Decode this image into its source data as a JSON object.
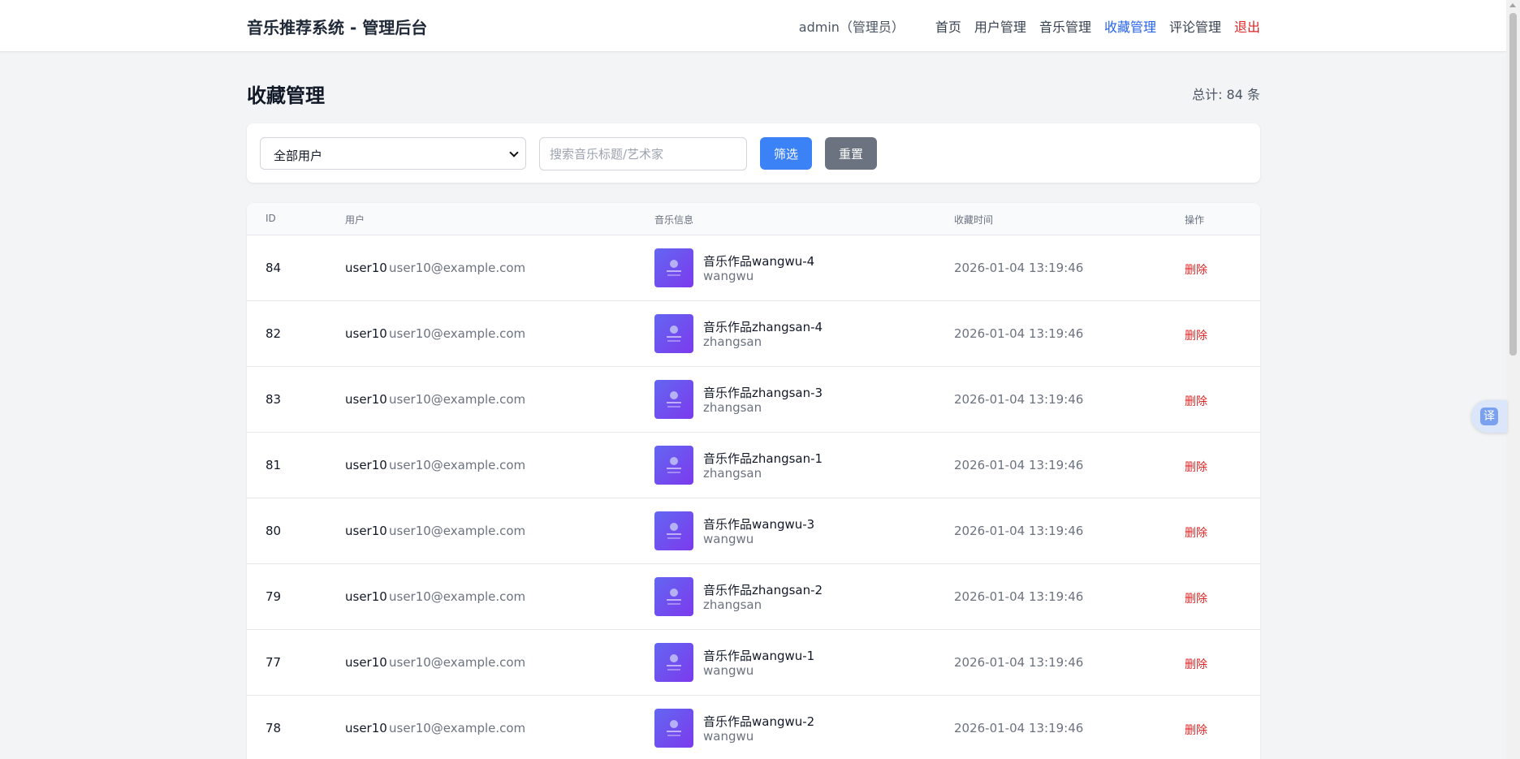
{
  "header": {
    "brand": "音乐推荐系统 - 管理后台",
    "current_user": "admin（管理员）",
    "nav": [
      "首页",
      "用户管理",
      "音乐管理",
      "收藏管理",
      "评论管理",
      "退出"
    ],
    "active_nav": "收藏管理"
  },
  "page": {
    "title": "收藏管理",
    "total": "总计: 84 条"
  },
  "filter": {
    "user_select_value": "全部用户",
    "search_placeholder": "搜索音乐标题/艺术家",
    "filter_button": "筛选",
    "reset_button": "重置"
  },
  "table": {
    "headers": [
      "ID",
      "用户",
      "音乐信息",
      "收藏时间",
      "操作"
    ],
    "rows": [
      {
        "id": "84",
        "username": "user10",
        "email": "user10@example.com",
        "title": "音乐作品wangwu-4",
        "artist": "wangwu",
        "time": "2026-01-04 13:19:46",
        "action": "删除"
      },
      {
        "id": "82",
        "username": "user10",
        "email": "user10@example.com",
        "title": "音乐作品zhangsan-4",
        "artist": "zhangsan",
        "time": "2026-01-04 13:19:46",
        "action": "删除"
      },
      {
        "id": "83",
        "username": "user10",
        "email": "user10@example.com",
        "title": "音乐作品zhangsan-3",
        "artist": "zhangsan",
        "time": "2026-01-04 13:19:46",
        "action": "删除"
      },
      {
        "id": "81",
        "username": "user10",
        "email": "user10@example.com",
        "title": "音乐作品zhangsan-1",
        "artist": "zhangsan",
        "time": "2026-01-04 13:19:46",
        "action": "删除"
      },
      {
        "id": "80",
        "username": "user10",
        "email": "user10@example.com",
        "title": "音乐作品wangwu-3",
        "artist": "wangwu",
        "time": "2026-01-04 13:19:46",
        "action": "删除"
      },
      {
        "id": "79",
        "username": "user10",
        "email": "user10@example.com",
        "title": "音乐作品zhangsan-2",
        "artist": "zhangsan",
        "time": "2026-01-04 13:19:46",
        "action": "删除"
      },
      {
        "id": "77",
        "username": "user10",
        "email": "user10@example.com",
        "title": "音乐作品wangwu-1",
        "artist": "wangwu",
        "time": "2026-01-04 13:19:46",
        "action": "删除"
      },
      {
        "id": "78",
        "username": "user10",
        "email": "user10@example.com",
        "title": "音乐作品wangwu-2",
        "artist": "wangwu",
        "time": "2026-01-04 13:19:46",
        "action": "删除"
      }
    ]
  },
  "translate_widget": {
    "label": "译"
  },
  "colors": {
    "accent": "#3b82f6",
    "active_nav": "#2563eb",
    "danger": "#dc2626",
    "reset": "#6b7280",
    "cover_gradient_start": "#6366f1",
    "cover_gradient_end": "#7c3aed"
  }
}
